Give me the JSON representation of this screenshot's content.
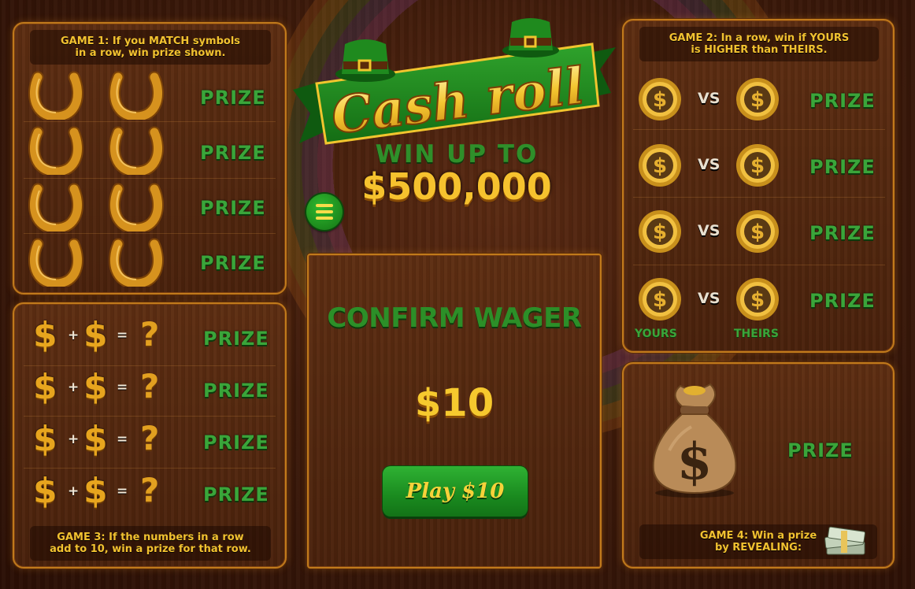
{
  "game_title": "Cash roll",
  "tagline": "WIN UP TO",
  "jackpot": "$500,000",
  "game1": {
    "rule_line1": "GAME 1: If you MATCH symbols",
    "rule_line2": "in a row, win prize shown.",
    "rows": [
      {
        "prize": "PRIZE"
      },
      {
        "prize": "PRIZE"
      },
      {
        "prize": "PRIZE"
      },
      {
        "prize": "PRIZE"
      }
    ]
  },
  "game2": {
    "rule_line1": "GAME 2: In a row, win if YOURS",
    "rule_line2": "is HIGHER than THEIRS.",
    "vs_label": "VS",
    "yours_label": "YOURS",
    "theirs_label": "THEIRS",
    "rows": [
      {
        "prize": "PRIZE"
      },
      {
        "prize": "PRIZE"
      },
      {
        "prize": "PRIZE"
      },
      {
        "prize": "PRIZE"
      }
    ]
  },
  "game3": {
    "rule_line1": "GAME 3: If the numbers in a row",
    "rule_line2": "add to 10, win a prize for that row.",
    "symbol": "$",
    "plus": "+",
    "equals": "=",
    "unknown": "?",
    "rows": [
      {
        "prize": "PRIZE"
      },
      {
        "prize": "PRIZE"
      },
      {
        "prize": "PRIZE"
      },
      {
        "prize": "PRIZE"
      }
    ]
  },
  "game4": {
    "rule_line1": "GAME 4: Win a prize",
    "rule_line2": "by REVEALING:",
    "prize": "PRIZE"
  },
  "center": {
    "confirm_title": "CONFIRM WAGER",
    "wager_amount": "$10",
    "play_button": "Play $10"
  },
  "colors": {
    "prize_green": "#3aa53a",
    "gold": "#f6c22e",
    "panel_border": "#c07a1c"
  }
}
